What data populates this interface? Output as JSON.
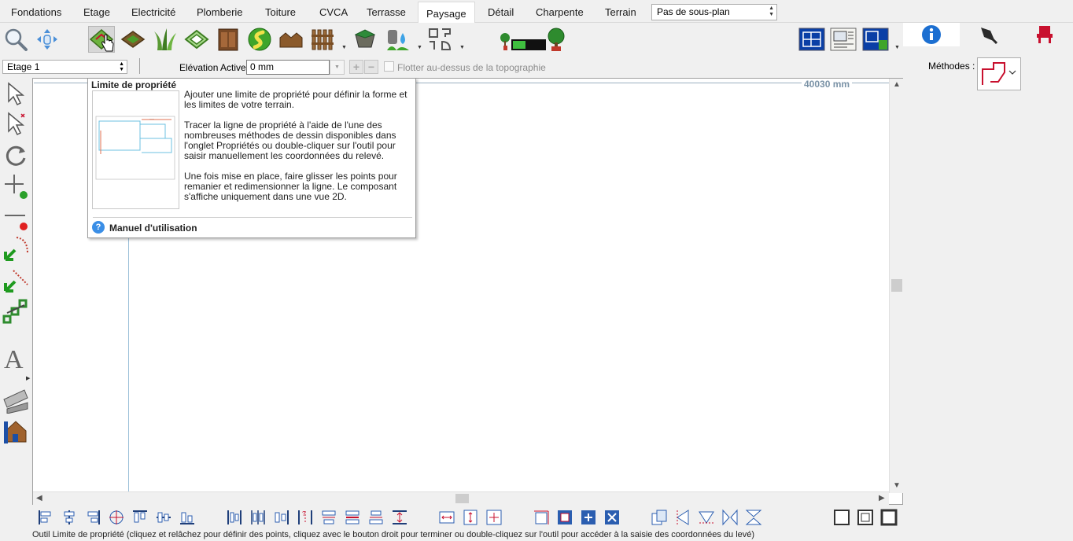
{
  "tabs": [
    {
      "label": "Fondations"
    },
    {
      "label": "Etage"
    },
    {
      "label": "Electricité"
    },
    {
      "label": "Plomberie"
    },
    {
      "label": "Toiture"
    },
    {
      "label": "CVCA"
    },
    {
      "label": "Terrasse"
    },
    {
      "label": "Paysage",
      "active": true
    },
    {
      "label": "Détail"
    },
    {
      "label": "Charpente"
    },
    {
      "label": "Terrain"
    }
  ],
  "subplan_select": {
    "value": "Pas de sous-plan"
  },
  "toolbar": {
    "icons": [
      "zoom-icon",
      "pan-icon",
      "property-line-icon",
      "garden-bed-icon",
      "grass-icon",
      "lawn-icon",
      "cabinet-icon",
      "path-icon",
      "hedge-icon",
      "fence-icon",
      "pond-icon",
      "water-icon",
      "shapes-icon",
      "plant-growth-icon",
      "tree-icon",
      "plan-view-icon",
      "layout-view-icon",
      "site-plan-view-icon"
    ]
  },
  "right_panel": {
    "tabs": [
      "info-icon",
      "pen-icon",
      "chair-icon"
    ],
    "methods_label": "Méthodes :"
  },
  "row2": {
    "level_select": "Etage 1",
    "elevation_label": "Elévation Active:",
    "elevation_value": "0 mm",
    "float_label": "Flotter au-dessus de la topographie",
    "float_checked": false
  },
  "canvas": {
    "dimension_text": "40030 mm"
  },
  "tooltip": {
    "title": "Limite de propriété",
    "paragraphs": [
      "Ajouter une limite de propriété pour définir la forme et les limites de votre terrain.",
      "Tracer la ligne de propriété à l'aide de l'une des nombreuses méthodes de dessin disponibles dans l'onglet Propriétés ou double-cliquer sur l'outil pour saisir manuellement les coordonnées du relevé.",
      "Une fois mise en place, faire glisser les points pour remanier et redimensionner la ligne. Le composant s'affiche uniquement dans une vue 2D."
    ],
    "help_link": "Manuel d'utilisation"
  },
  "status_bar": {
    "text": "Outil Limite de propriété (cliquez et relâchez pour définir des points, cliquez avec le bouton droit pour terminer ou double-cliquez sur l'outil pour accéder à la saisie des coordonnées du levé)"
  },
  "colors": {
    "info_blue": "#1c6fd1",
    "property_red": "#c8102e",
    "green": "#2aa02a"
  }
}
